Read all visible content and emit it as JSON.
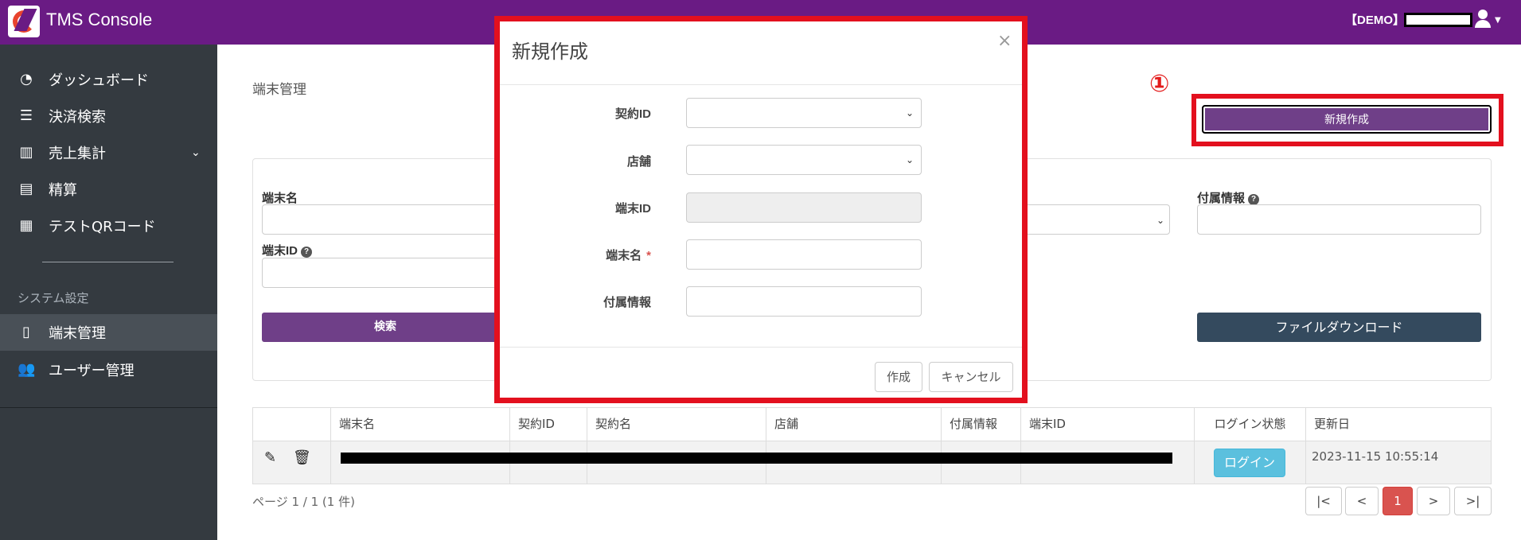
{
  "header": {
    "app_title": "TMS Console",
    "env_badge": "【DEMO】",
    "logo_icon": "tms-logo-icon",
    "user_icon": "user-icon"
  },
  "sidebar": {
    "items": [
      {
        "label": "ダッシュボード",
        "icon": "dashboard-icon"
      },
      {
        "label": "決済検索",
        "icon": "list-icon"
      },
      {
        "label": "売上集計",
        "icon": "bar-chart-icon"
      },
      {
        "label": "精算",
        "icon": "receipt-icon"
      },
      {
        "label": "テストQRコード",
        "icon": "qr-code-icon"
      }
    ],
    "section_label": "システム設定",
    "settings_items": [
      {
        "label": "端末管理",
        "icon": "tablet-icon"
      },
      {
        "label": "ユーザー管理",
        "icon": "users-icon"
      }
    ]
  },
  "main": {
    "page_title": "端末管理",
    "annotation_marker": "①",
    "new_button": "新規作成",
    "search": {
      "terminal_name_label": "端末名",
      "terminal_id_label": "端末ID",
      "attached_info_label": "付属情報",
      "search_button": "検索",
      "download_button": "ファイルダウンロード"
    },
    "table": {
      "headers": [
        "",
        "端末名",
        "契約ID",
        "契約名",
        "店舗",
        "付属情報",
        "端末ID",
        "ログイン状態",
        "更新日"
      ],
      "row": {
        "login_status": "ログイン",
        "updated_at": "2023-11-15 10:55:14"
      }
    },
    "pagination": {
      "info": "ページ 1 / 1 (1 件)",
      "first": "|<",
      "prev": "<",
      "current": "1",
      "next": ">",
      "last": ">|"
    }
  },
  "modal": {
    "title": "新規作成",
    "close": "×",
    "fields": {
      "contract_id": "契約ID",
      "store": "店舗",
      "terminal_id": "端末ID",
      "terminal_name": "端末名",
      "required_mark": "*",
      "attached_info": "付属情報"
    },
    "create_button": "作成",
    "cancel_button": "キャンセル"
  },
  "colors": {
    "header_bg": "#6a1b84",
    "sidebar_bg": "#343a40",
    "primary_button": "#6f3f88",
    "download_button": "#344a5e",
    "highlight_frame": "#e3101e",
    "login_badge": "#5bc0de",
    "current_page": "#d9534f"
  }
}
